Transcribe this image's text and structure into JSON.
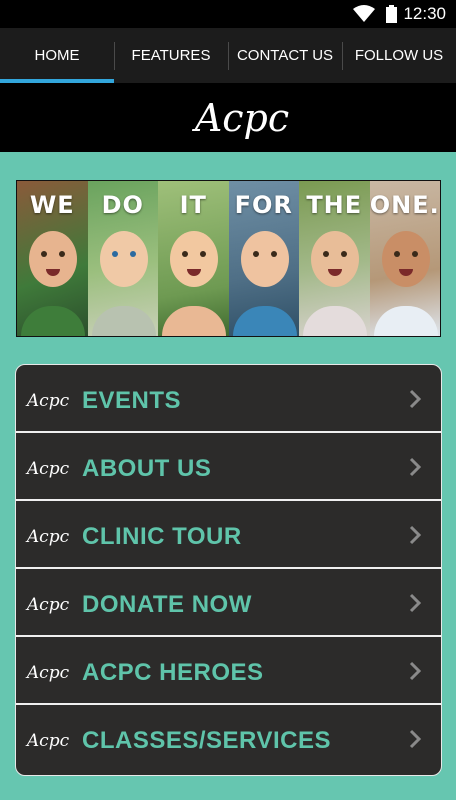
{
  "status_bar": {
    "time": "12:30"
  },
  "tabs": [
    {
      "label": "HOME",
      "active": true
    },
    {
      "label": "FEATURES",
      "active": false
    },
    {
      "label": "CONTACT US",
      "active": false
    },
    {
      "label": "FOLLOW US",
      "active": false
    }
  ],
  "logo": {
    "text": "Acpc"
  },
  "banner": {
    "words": [
      "WE",
      "DO",
      "IT",
      "FOR",
      "THE",
      "ONE."
    ]
  },
  "menu": {
    "mini_logo_text": "Acpc",
    "items": [
      {
        "label": "EVENTS"
      },
      {
        "label": "ABOUT US"
      },
      {
        "label": "CLINIC TOUR"
      },
      {
        "label": "DONATE NOW"
      },
      {
        "label": "ACPC HEROES"
      },
      {
        "label": "CLASSES/SERVICES"
      }
    ]
  },
  "colors": {
    "background": "#66c6b0",
    "tab_indicator": "#32a6dc",
    "menu_label": "#5fc4aa",
    "menu_background": "#2c2b2a"
  }
}
